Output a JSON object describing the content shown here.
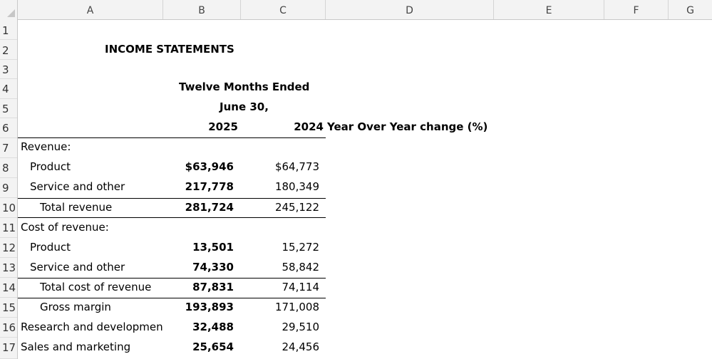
{
  "columns": [
    "A",
    "B",
    "C",
    "D",
    "E",
    "F",
    "G"
  ],
  "rows": [
    "1",
    "2",
    "3",
    "4",
    "5",
    "6",
    "7",
    "8",
    "9",
    "10",
    "11",
    "12",
    "13",
    "14",
    "15",
    "16",
    "17"
  ],
  "title": "INCOME STATEMENTS",
  "period_line1": "Twelve Months Ended",
  "period_line2": "June 30,",
  "year_current": "2025",
  "year_prior": "2024",
  "yoy_header": "Year Over Year change (%)",
  "lines": [
    {
      "label": "Revenue:",
      "cur": "",
      "prior": ""
    },
    {
      "label": "Product",
      "cur": "$63,946",
      "prior": "$64,773"
    },
    {
      "label": "Service and other",
      "cur": "217,778",
      "prior": "180,349"
    },
    {
      "label": "Total revenue",
      "cur": "281,724",
      "prior": "245,122"
    },
    {
      "label": "Cost of revenue:",
      "cur": "",
      "prior": ""
    },
    {
      "label": "Product",
      "cur": "13,501",
      "prior": "15,272"
    },
    {
      "label": "Service and other",
      "cur": "74,330",
      "prior": "58,842"
    },
    {
      "label": "Total cost of revenue",
      "cur": "87,831",
      "prior": "74,114"
    },
    {
      "label": "Gross margin",
      "cur": "193,893",
      "prior": "171,008"
    },
    {
      "label": "Research and developmen",
      "cur": "32,488",
      "prior": "29,510"
    },
    {
      "label": "Sales and marketing",
      "cur": "25,654",
      "prior": "24,456"
    }
  ]
}
